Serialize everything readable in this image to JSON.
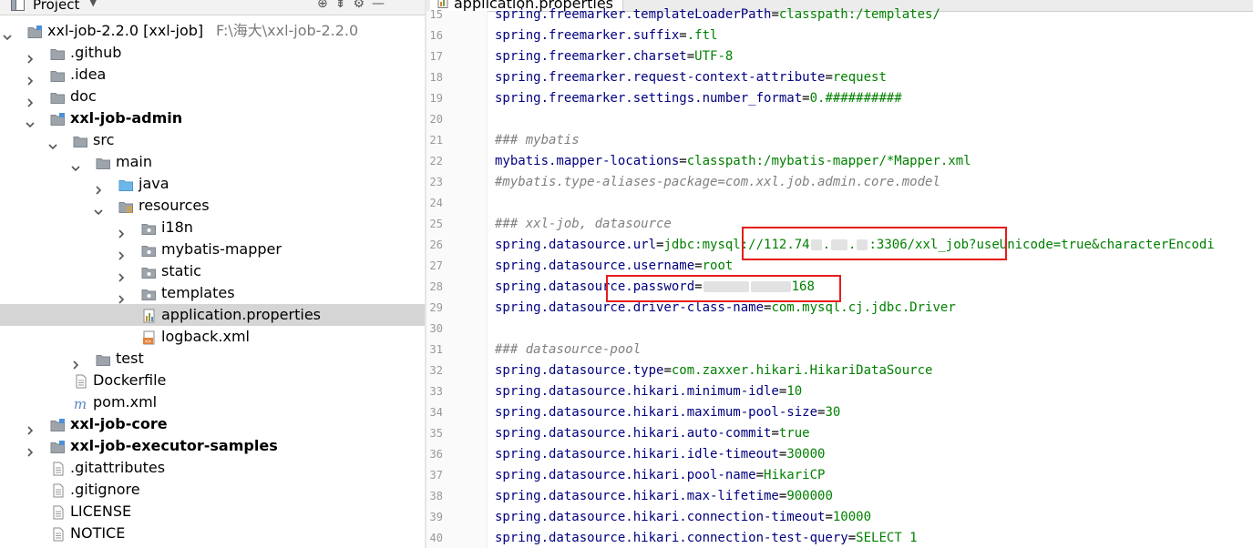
{
  "project_panel": {
    "title": "Project",
    "tree": [
      {
        "label": "xxl-job-2.2.0 [xxl-job]",
        "hint": "F:\\海大\\xxl-job-2.2.0",
        "bold": false,
        "icon": "module-folder-icon",
        "expanded": true,
        "depth": 0
      },
      {
        "label": ".github",
        "bold": false,
        "icon": "folder-icon",
        "expanded": false,
        "depth": 1
      },
      {
        "label": ".idea",
        "bold": false,
        "icon": "folder-icon",
        "expanded": false,
        "depth": 1
      },
      {
        "label": "doc",
        "bold": false,
        "icon": "folder-icon",
        "expanded": false,
        "depth": 1
      },
      {
        "label": "xxl-job-admin",
        "bold": true,
        "icon": "module-folder-icon",
        "expanded": true,
        "depth": 1
      },
      {
        "label": "src",
        "bold": false,
        "icon": "folder-icon",
        "expanded": true,
        "depth": 2
      },
      {
        "label": "main",
        "bold": false,
        "icon": "folder-icon",
        "expanded": true,
        "depth": 3
      },
      {
        "label": "java",
        "bold": false,
        "icon": "source-folder-icon",
        "expanded": false,
        "depth": 4
      },
      {
        "label": "resources",
        "bold": false,
        "icon": "resources-folder-icon",
        "expanded": true,
        "depth": 4
      },
      {
        "label": "i18n",
        "bold": false,
        "icon": "package-folder-icon",
        "expanded": false,
        "depth": 5
      },
      {
        "label": "mybatis-mapper",
        "bold": false,
        "icon": "package-folder-icon",
        "expanded": false,
        "depth": 5
      },
      {
        "label": "static",
        "bold": false,
        "icon": "package-folder-icon",
        "expanded": false,
        "depth": 5
      },
      {
        "label": "templates",
        "bold": false,
        "icon": "package-folder-icon",
        "expanded": false,
        "depth": 5
      },
      {
        "label": "application.properties",
        "bold": false,
        "icon": "properties-file-icon",
        "expanded": null,
        "depth": 5,
        "selected": true
      },
      {
        "label": "logback.xml",
        "bold": false,
        "icon": "xml-file-icon",
        "expanded": null,
        "depth": 5
      },
      {
        "label": "test",
        "bold": false,
        "icon": "folder-icon",
        "expanded": false,
        "depth": 3
      },
      {
        "label": "Dockerfile",
        "bold": false,
        "icon": "text-file-icon",
        "expanded": null,
        "depth": 2
      },
      {
        "label": "pom.xml",
        "bold": false,
        "icon": "maven-file-icon",
        "expanded": null,
        "depth": 2
      },
      {
        "label": "xxl-job-core",
        "bold": true,
        "icon": "module-folder-icon",
        "expanded": false,
        "depth": 1
      },
      {
        "label": "xxl-job-executor-samples",
        "bold": true,
        "icon": "module-folder-icon",
        "expanded": false,
        "depth": 1
      },
      {
        "label": ".gitattributes",
        "bold": false,
        "icon": "text-file-icon",
        "expanded": null,
        "depth": 1
      },
      {
        "label": ".gitignore",
        "bold": false,
        "icon": "text-file-icon",
        "expanded": null,
        "depth": 1
      },
      {
        "label": "LICENSE",
        "bold": false,
        "icon": "text-file-icon",
        "expanded": null,
        "depth": 1
      },
      {
        "label": "NOTICE",
        "bold": false,
        "icon": "text-file-icon",
        "expanded": null,
        "depth": 1
      }
    ]
  },
  "editor": {
    "tab_label": "application.properties",
    "lines": [
      {
        "n": "15",
        "key": "spring.freemarker.templateLoaderPath",
        "value": "classpath:/templates/"
      },
      {
        "n": "16",
        "key": "spring.freemarker.suffix",
        "value": ".ftl"
      },
      {
        "n": "17",
        "key": "spring.freemarker.charset",
        "value": "UTF-8"
      },
      {
        "n": "18",
        "key": "spring.freemarker.request-context-attribute",
        "value": "request"
      },
      {
        "n": "19",
        "key": "spring.freemarker.settings.number_format",
        "value": "0.##########"
      },
      {
        "n": "20"
      },
      {
        "n": "21",
        "comment": "### mybatis"
      },
      {
        "n": "22",
        "key": "mybatis.mapper-locations",
        "value": "classpath:/mybatis-mapper/*Mapper.xml"
      },
      {
        "n": "23",
        "comment": "#mybatis.type-aliases-package=com.xxl.job.admin.core.model"
      },
      {
        "n": "24"
      },
      {
        "n": "25",
        "comment": "### xxl-job, datasource"
      },
      {
        "n": "26",
        "key": "spring.datasource.url",
        "value_parts": [
          "jdbc:mysql://112.74",
          ".",
          ".",
          ":3306/xxl_job?useUnicode=true&characterEncodi"
        ]
      },
      {
        "n": "27",
        "key": "spring.datasource.username",
        "value": "root"
      },
      {
        "n": "28",
        "key": "spring.datasource.password",
        "value_parts": [
          "",
          "",
          "168"
        ]
      },
      {
        "n": "29",
        "key": "spring.datasource.driver-class-name",
        "value": "com.mysql.cj.jdbc.Driver"
      },
      {
        "n": "30"
      },
      {
        "n": "31",
        "comment": "### datasource-pool"
      },
      {
        "n": "32",
        "key": "spring.datasource.type",
        "value": "com.zaxxer.hikari.HikariDataSource"
      },
      {
        "n": "33",
        "key": "spring.datasource.hikari.minimum-idle",
        "value": "10"
      },
      {
        "n": "34",
        "key": "spring.datasource.hikari.maximum-pool-size",
        "value": "30"
      },
      {
        "n": "35",
        "key": "spring.datasource.hikari.auto-commit",
        "value": "true"
      },
      {
        "n": "36",
        "key": "spring.datasource.hikari.idle-timeout",
        "value": "30000"
      },
      {
        "n": "37",
        "key": "spring.datasource.hikari.pool-name",
        "value": "HikariCP"
      },
      {
        "n": "38",
        "key": "spring.datasource.hikari.max-lifetime",
        "value": "900000"
      },
      {
        "n": "39",
        "key": "spring.datasource.hikari.connection-timeout",
        "value": "10000"
      },
      {
        "n": "40",
        "key": "spring.datasource.hikari.connection-test-query",
        "value": "SELECT 1"
      }
    ]
  },
  "colors": {
    "annotation": "#e81c1c",
    "key": "#000080",
    "value": "#008000",
    "comment": "#808080",
    "selection": "#d5d5d5"
  }
}
